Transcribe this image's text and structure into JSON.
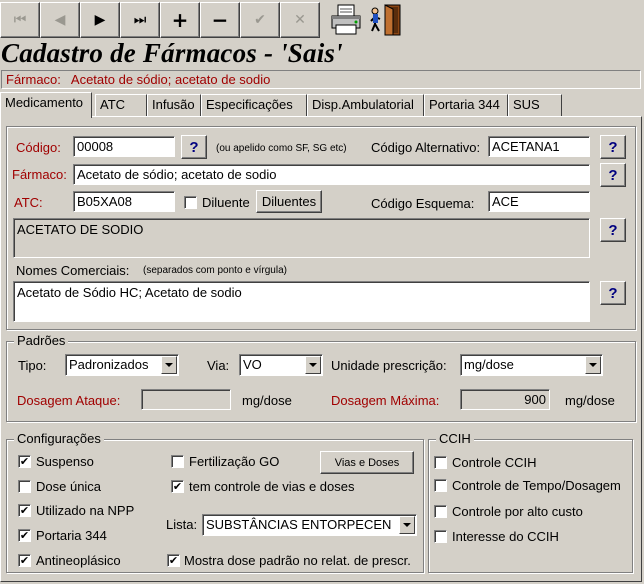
{
  "toolbar": {
    "first": "⏮",
    "prior": "◀",
    "next": "▶",
    "last": "⏭",
    "insert": "+",
    "delete": "−",
    "post": "✔",
    "cancel": "✕"
  },
  "window": {
    "title": "Cadastro de Fármacos - 'Sais'"
  },
  "farmaco_bar": {
    "label": "Fármaco:",
    "value": "Acetato de sódio; acetato de sodio"
  },
  "tabs": [
    {
      "label": "Medicamento"
    },
    {
      "label": "ATC"
    },
    {
      "label": "Infusão"
    },
    {
      "label": "Especificações"
    },
    {
      "label": "Disp.Ambulatorial"
    },
    {
      "label": "Portaria 344"
    },
    {
      "label": "SUS"
    }
  ],
  "medicamento": {
    "codigo_label": "Código:",
    "codigo_value": "00008",
    "codigo_hint": "(ou apelido como SF, SG etc)",
    "codigo_alt_label": "Código Alternativo:",
    "codigo_alt_value": "ACETANA1",
    "farmaco_label": "Fármaco:",
    "farmaco_value": "Acetato de sódio; acetato de sodio",
    "atc_label": "ATC:",
    "atc_value": "B05XA08",
    "diluente_label": "Diluente",
    "diluentes_button": "Diluentes",
    "codigo_esquema_label": "Código Esquema:",
    "codigo_esquema_value": "ACE",
    "atc_description": "ACETATO DE SODIO",
    "nomes_comerciais_label": "Nomes Comerciais:",
    "nomes_comerciais_hint": "(separados com ponto e vírgula)",
    "nomes_comerciais_value": "Acetato de Sódio HC; Acetato de sodio",
    "help": "?"
  },
  "padroes": {
    "title": "Padrões",
    "tipo_label": "Tipo:",
    "tipo_value": "Padronizados",
    "via_label": "Via:",
    "via_value": "VO",
    "unidade_label": "Unidade prescrição:",
    "unidade_value": "mg/dose",
    "dosagem_ataque_label": "Dosagem Ataque:",
    "dosagem_ataque_value": "",
    "dosagem_ataque_unit": "mg/dose",
    "dosagem_maxima_label": "Dosagem Máxima:",
    "dosagem_maxima_value": "900",
    "dosagem_maxima_unit": "mg/dose"
  },
  "configuracoes": {
    "title": "Configurações",
    "suspenso": "Suspenso",
    "dose_unica": "Dose única",
    "utilizado_npp": "Utilizado na NPP",
    "portaria_344": "Portaria 344",
    "antineoplasico": "Antineoplásico",
    "fertilizacao_go": "Fertilização GO",
    "tem_controle": "tem controle de vias e doses",
    "lista_label": "Lista:",
    "lista_value": "SUBSTÂNCIAS ENTORPECEN",
    "mostra_dose": "Mostra dose padrão no relat. de prescr.",
    "vias_doses_button": "Vias e Doses"
  },
  "ccih": {
    "title": "CCIH",
    "controle_ccih": "Controle CCIH",
    "controle_tempo": "Controle de Tempo/Dosagem",
    "controle_custo": "Controle por alto custo",
    "interesse": "Interesse do CCIH"
  },
  "checkbox_mark": "✔",
  "colors": {
    "label_red": "#a00000",
    "help_blue": "#000080",
    "face": "#d4d0c8"
  }
}
